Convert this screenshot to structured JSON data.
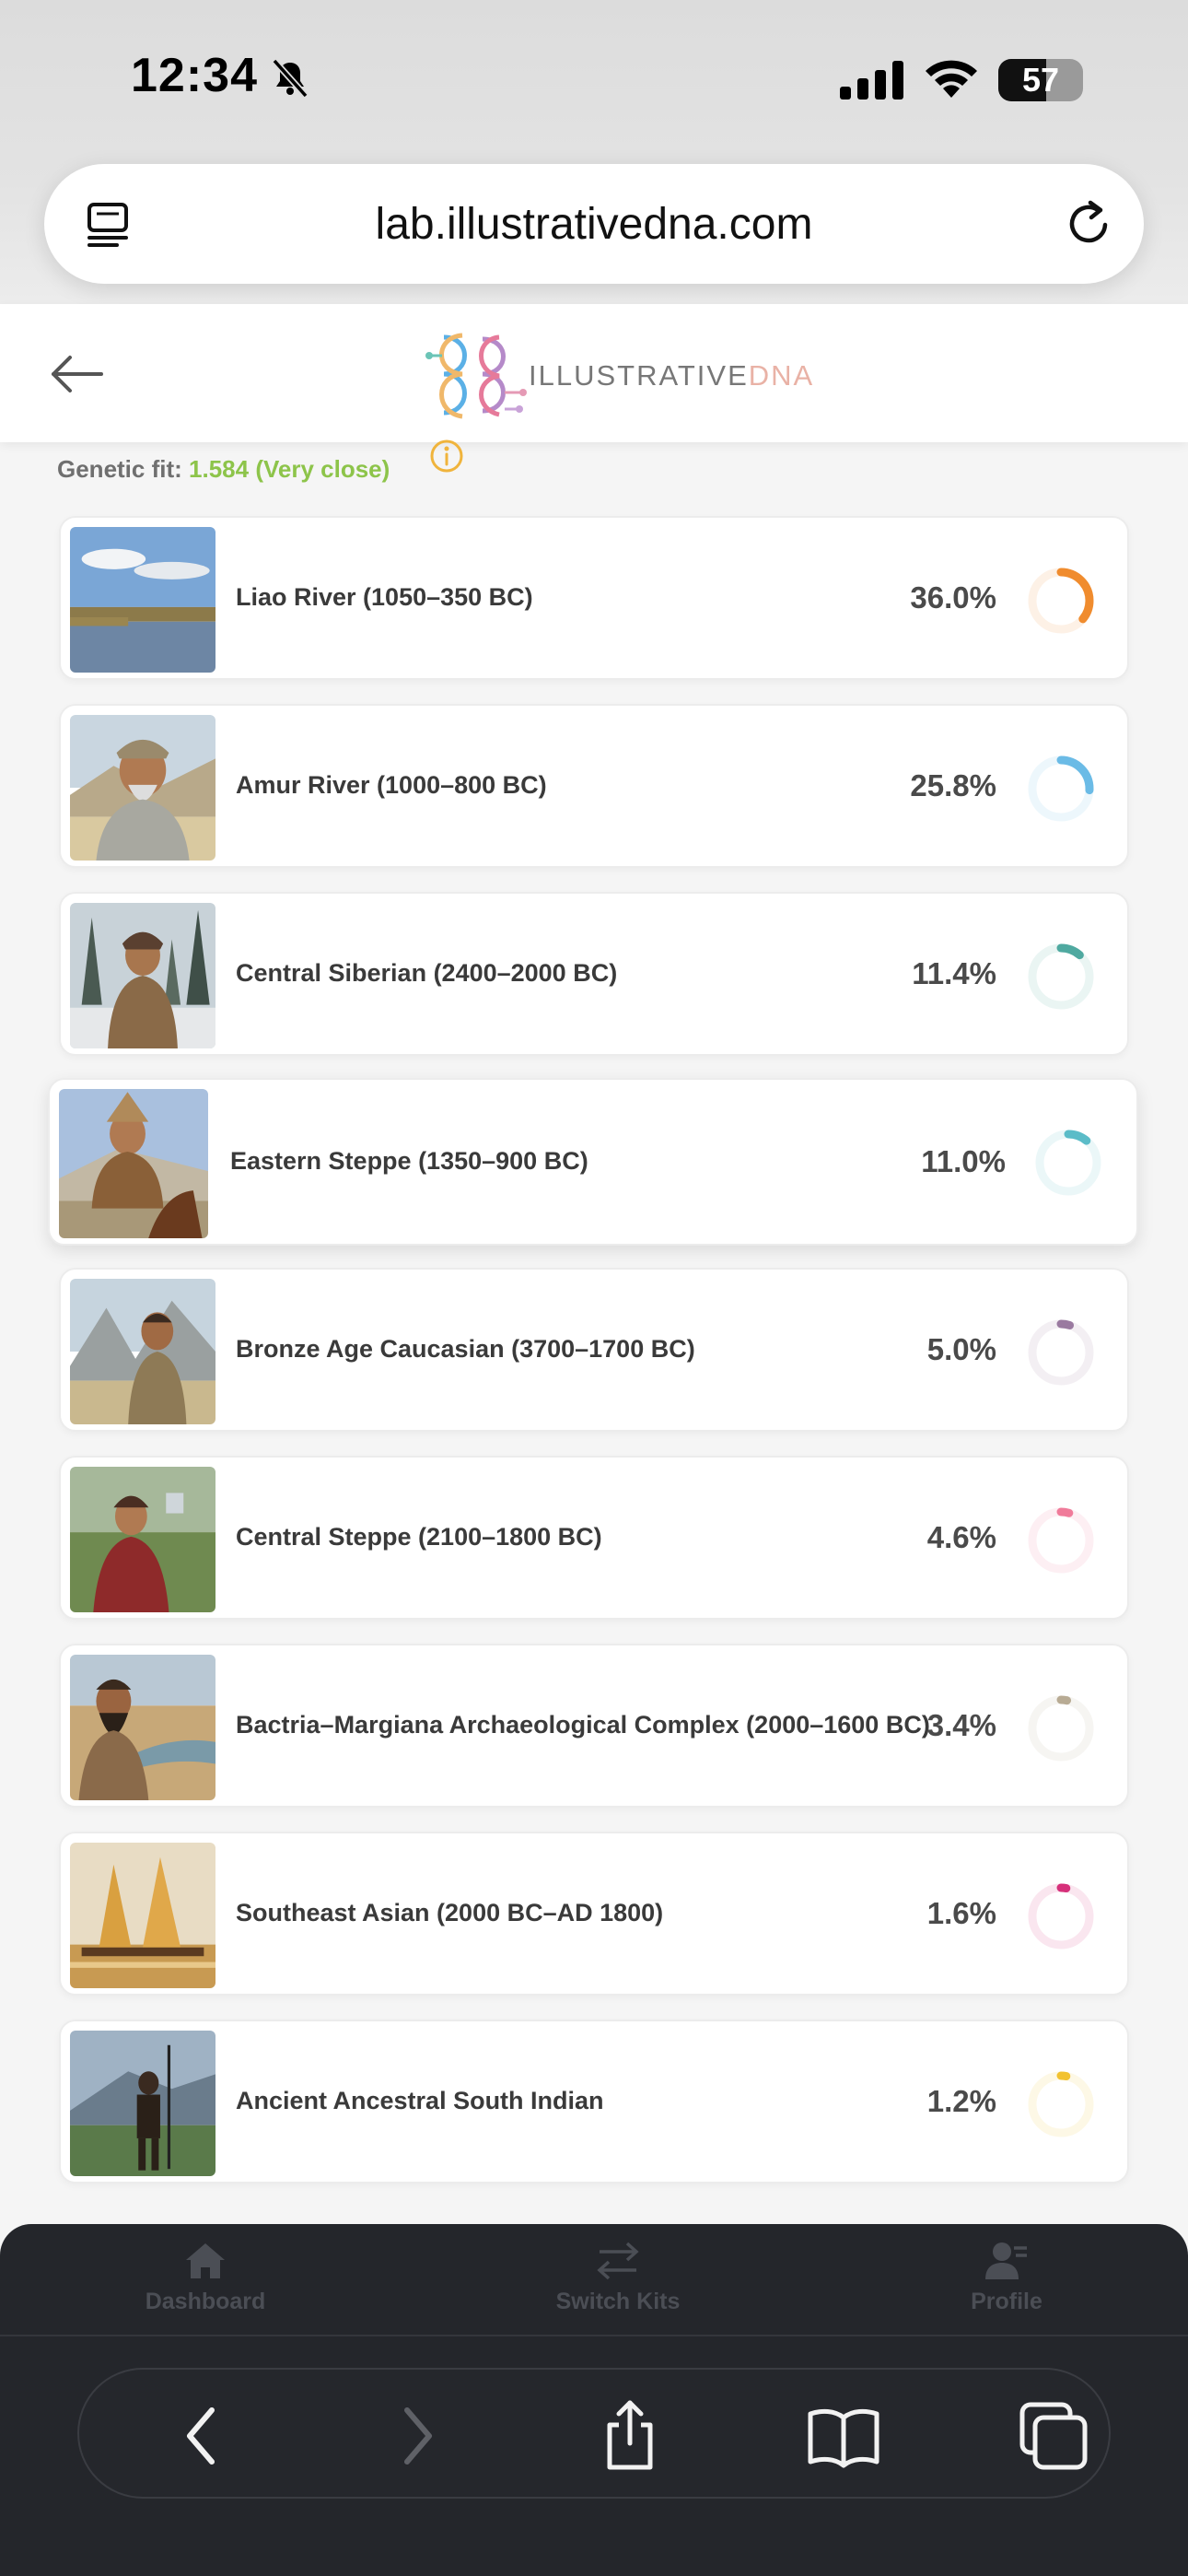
{
  "status_bar": {
    "time": "12:34",
    "battery": "57",
    "battery_level": 0.57
  },
  "browser": {
    "url": "lab.illustrativedna.com"
  },
  "header": {
    "logo_text_main": "ILLUSTRATIVE",
    "logo_text_accent": "DNA"
  },
  "fit": {
    "label": "Genetic fit:",
    "value": "1.584 (Very close)"
  },
  "results": [
    {
      "name": "Liao River (1050–350 BC)",
      "percent": "36.0%",
      "value": 36.0,
      "color": "#f08c2e"
    },
    {
      "name": "Amur River (1000–800 BC)",
      "percent": "25.8%",
      "value": 25.8,
      "color": "#6bbbe6"
    },
    {
      "name": "Central Siberian (2400–2000 BC)",
      "percent": "11.4%",
      "value": 11.4,
      "color": "#4fa9a0"
    },
    {
      "name": "Eastern Steppe (1350–900 BC)",
      "percent": "11.0%",
      "value": 11.0,
      "color": "#5bbcc8"
    },
    {
      "name": "Bronze Age Caucasian (3700–1700 BC)",
      "percent": "5.0%",
      "value": 5.0,
      "color": "#9a7aa0"
    },
    {
      "name": "Central Steppe (2100–1800 BC)",
      "percent": "4.6%",
      "value": 4.6,
      "color": "#f07b9a"
    },
    {
      "name": "Bactria–Margiana Archaeological Complex (2000–1600 BC)",
      "percent": "3.4%",
      "value": 3.4,
      "color": "#b8ab94"
    },
    {
      "name": "Southeast Asian (2000 BC–AD 1800)",
      "percent": "1.6%",
      "value": 1.6,
      "color": "#d6307a"
    },
    {
      "name": "Ancient Ancestral South Indian",
      "percent": "1.2%",
      "value": 1.2,
      "color": "#f2c230"
    }
  ],
  "tabbar": {
    "dashboard": "Dashboard",
    "switch_kits": "Switch Kits",
    "profile": "Profile"
  },
  "icons": {
    "status": [
      "bell-slash-icon",
      "signal-icon",
      "wifi-icon",
      "battery-icon"
    ],
    "browser": [
      "reader-mode-icon",
      "reload-icon"
    ],
    "toolbar": [
      "back-icon",
      "forward-icon",
      "share-icon",
      "bookmarks-icon",
      "tabs-icon"
    ]
  }
}
